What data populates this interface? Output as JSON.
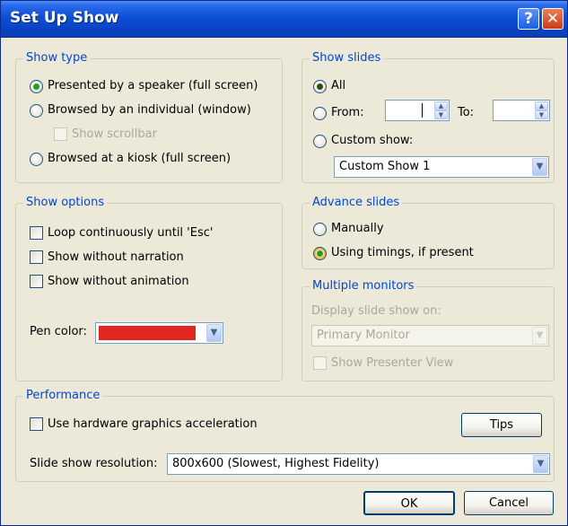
{
  "window": {
    "title": "Set Up Show",
    "help_glyph": "?",
    "close_glyph": "✕"
  },
  "show_type": {
    "label": "Show type",
    "options": [
      "Presented by a speaker (full screen)",
      "Browsed by an individual (window)",
      "Browsed at a kiosk (full screen)"
    ],
    "selected": "Presented by a speaker (full screen)",
    "show_scrollbar": "Show scrollbar"
  },
  "show_slides": {
    "label": "Show slides",
    "all": "All",
    "from": "From:",
    "to": "To:",
    "from_value": "",
    "to_value": "",
    "custom_show": "Custom show:",
    "custom_show_value": "Custom Show 1",
    "selected": "All"
  },
  "show_options": {
    "label": "Show options",
    "loop": "Loop continuously until 'Esc'",
    "no_narration": "Show without narration",
    "no_animation": "Show without animation",
    "pen_color_label": "Pen color:",
    "pen_color": "#e32620"
  },
  "advance_slides": {
    "label": "Advance slides",
    "manually": "Manually",
    "timings": "Using timings, if present",
    "selected": "Using timings, if present"
  },
  "multiple_monitors": {
    "label": "Multiple monitors",
    "display_on": "Display slide show on:",
    "monitor_value": "Primary Monitor",
    "presenter_view": "Show Presenter View"
  },
  "performance": {
    "label": "Performance",
    "hardware_accel": "Use hardware graphics acceleration",
    "tips": "Tips",
    "resolution_label": "Slide show resolution:",
    "resolution_value": "800x600 (Slowest, Highest Fidelity)"
  },
  "buttons": {
    "ok": "OK",
    "cancel": "Cancel"
  },
  "icons": {
    "dropdown_arrow": "▼",
    "spin_up": "▲",
    "spin_down": "▼"
  },
  "colors": {
    "title_blue": "#0843c4",
    "group_label": "#0046d5",
    "radio_dot": "#21a121"
  }
}
